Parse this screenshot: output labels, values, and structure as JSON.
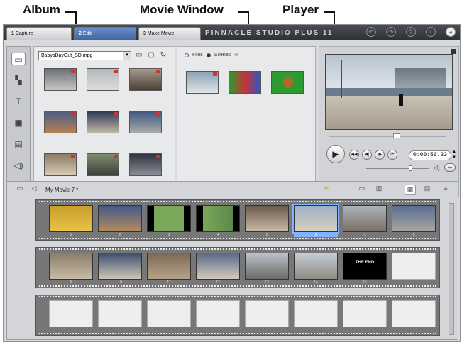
{
  "callouts": {
    "album": "Album",
    "movie_window": "Movie Window",
    "player": "Player"
  },
  "tabs": [
    {
      "num": "1",
      "label": "Capture"
    },
    {
      "num": "2",
      "label": "Edit"
    },
    {
      "num": "3",
      "label": "Make Movie"
    }
  ],
  "brand": "PINNACLE STUDIO PLUS 11",
  "album": {
    "file_select": "BabysDayOut_SD.mpg"
  },
  "scenes": {
    "radio_files": "Files",
    "radio_scenes": "Scenes"
  },
  "player": {
    "timecode": "0:00:56.23"
  },
  "movie": {
    "title": "My Movie 7 *",
    "row1_numbers": [
      "1",
      "2",
      "3",
      "4",
      "5",
      "6",
      "7",
      "8"
    ],
    "row2_numbers": [
      "9",
      "10",
      "11",
      "12",
      "13",
      "14",
      "15",
      ""
    ],
    "title_card_text": "THE END"
  },
  "colors": {
    "tabbar": "#3a3c40",
    "active_tab": "#4a72b5",
    "selection": "#7fb2ff"
  },
  "icons": [
    "search-icon",
    "folder-icon",
    "gear-icon",
    "help-icon",
    "undo-icon",
    "redo-icon",
    "play-icon",
    "rewind-icon",
    "forward-icon",
    "loop-icon",
    "volume-icon",
    "trash-icon",
    "storyboard-icon",
    "timeline-icon",
    "text-icon"
  ]
}
